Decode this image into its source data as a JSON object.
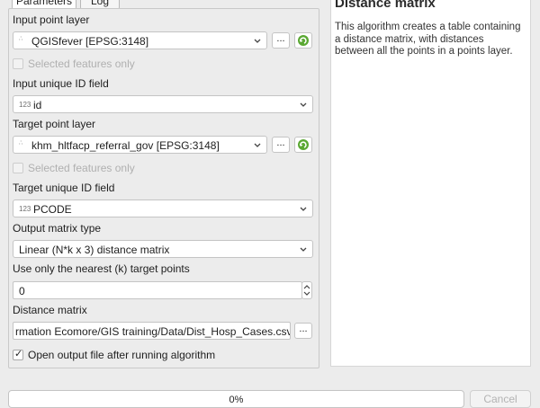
{
  "tabs": [
    {
      "label": "Parameters"
    },
    {
      "label": "Log"
    }
  ],
  "params": {
    "input_layer": {
      "label": "Input point layer",
      "value": "QGISfever [EPSG:3148]",
      "selected_only_label": "Selected features only"
    },
    "input_id": {
      "label": "Input unique ID field",
      "type_prefix": "123",
      "value": "id"
    },
    "target_layer": {
      "label": "Target point layer",
      "value": "khm_hltfacp_referral_gov [EPSG:3148]",
      "selected_only_label": "Selected features only"
    },
    "target_id": {
      "label": "Target unique ID field",
      "type_prefix": "123",
      "value": "PCODE"
    },
    "matrix_type": {
      "label": "Output matrix type",
      "value": "Linear (N*k x 3) distance matrix"
    },
    "nearest_k": {
      "label": "Use only the nearest (k) target points",
      "value": "0"
    },
    "output": {
      "label": "Distance matrix",
      "value": "rmation Ecomore/GIS training/Data/Dist_Hosp_Cases.csv"
    },
    "open_after": {
      "label": "Open output file after running algorithm",
      "checked": true
    },
    "browse_label": "...",
    "check_mark": "✓"
  },
  "help": {
    "title": "Distance matrix",
    "text": "This algorithm creates a table containing a distance matrix, with distances between all the points in a points layer."
  },
  "footer": {
    "progress_text": "0%",
    "progress_value": 0,
    "cancel_label": "Cancel"
  }
}
